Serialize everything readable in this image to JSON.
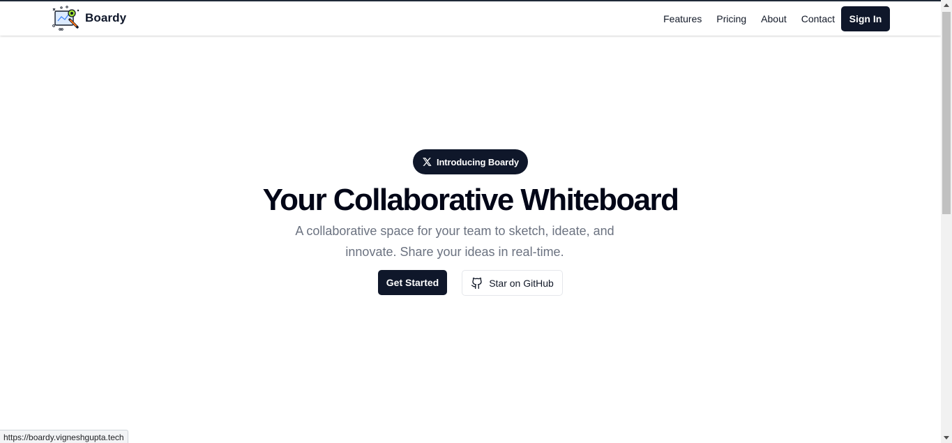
{
  "navbar": {
    "brand_name": "Boardy",
    "links": [
      {
        "label": "Features"
      },
      {
        "label": "Pricing"
      },
      {
        "label": "About"
      },
      {
        "label": "Contact"
      }
    ],
    "signin_label": "Sign In"
  },
  "hero": {
    "badge_label": "Introducing Boardy",
    "badge_icon": "x-logo-icon",
    "headline": "Your Collaborative Whiteboard",
    "subtext": "A collaborative space for your team to sketch, ideate, and innovate. Share your ideas in real-time.",
    "primary_button": "Get Started",
    "secondary_button": "Star on GitHub",
    "secondary_icon": "github-icon"
  },
  "status_bar": {
    "url": "https://boardy.vigneshgupta.tech"
  },
  "colors": {
    "primary": "#0f172a",
    "muted_text": "#6b7280",
    "background": "#ffffff"
  }
}
